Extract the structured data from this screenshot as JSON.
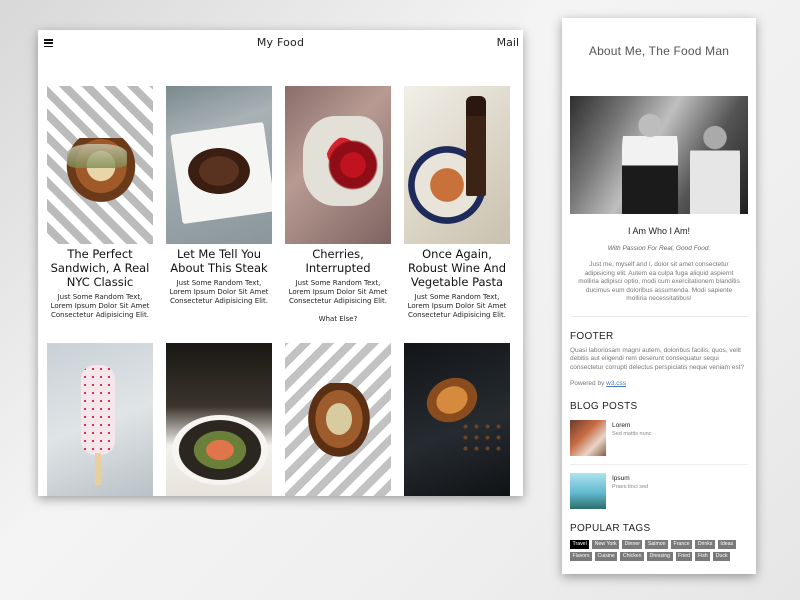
{
  "main": {
    "title": "My Food",
    "mail_label": "Mail",
    "cards": [
      {
        "title": "The Perfect Sandwich, A Real NYC Classic",
        "text": "Just Some Random Text, Lorem Ipsum Dolor Sit Amet Consectetur Adipisicing Elit.",
        "extra": ""
      },
      {
        "title": "Let Me Tell You About This Steak",
        "text": "Just Some Random Text, Lorem Ipsum Dolor Sit Amet Consectetur Adipisicing Elit.",
        "extra": ""
      },
      {
        "title": "Cherries, Interrupted",
        "text": "Just Some Random Text, Lorem Ipsum Dolor Sit Amet Consectetur Adipisicing Elit.",
        "extra": "What Else?"
      },
      {
        "title": "Once Again, Robust Wine And Vegetable Pasta",
        "text": "Just Some Random Text, Lorem Ipsum Dolor Sit Amet Consectetur Adipisicing Elit.",
        "extra": ""
      }
    ]
  },
  "side": {
    "header": "About Me, The Food Man",
    "about_heading": "I Am Who I Am!",
    "about_sub": "With Passion For Real, Good Food.",
    "about_text": "Just me, myself and I, dolor sit amet consectetur adipisicing elit. Autem ea culpa fuga aliquid aspiernt molliria adipisci optio, modi cum exercitationem blanditis ducimus eum doloribus assumenda. Modi sapiente molliria necessitatibus!",
    "footer_title": "FOOTER",
    "footer_text": "Quasi laboriosam magni autem, doloribus facilis, quos, velit debitis aut eligendi rem deserunt consequatur sequi consectetur corrupti delectus perspiciatis neque veniam est?",
    "powered_prefix": "Powered by",
    "powered_link": "w3.css",
    "blog_title": "BLOG POSTS",
    "posts": [
      {
        "title": "Lorem",
        "sub": "Sed mattis nunc"
      },
      {
        "title": "Ipsum",
        "sub": "Praes tinci sed"
      }
    ],
    "tags_title": "POPULAR TAGS",
    "tags": [
      "Travel",
      "New York",
      "Dinner",
      "Salmon",
      "France",
      "Drinks",
      "Ideas",
      "Flavors",
      "Cuisine",
      "Chicken",
      "Dressing",
      "Fried",
      "Fish",
      "Duck"
    ],
    "active_tag": "Travel"
  }
}
